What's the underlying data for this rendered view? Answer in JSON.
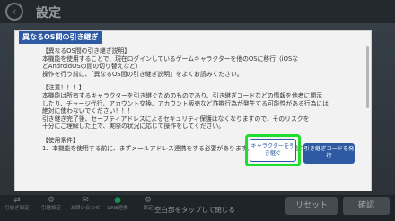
{
  "background": {
    "title": "設定",
    "nav": [
      {
        "label": "引継ぎ設定",
        "icon": "transfer-icon"
      },
      {
        "label": "引継設定",
        "icon": "settings-icon"
      },
      {
        "label": "お問い合わせ",
        "icon": "contact-icon"
      },
      {
        "label": "LINE連携",
        "icon": "line-icon"
      },
      {
        "label": "設定",
        "icon": "gear-icon"
      }
    ],
    "reset_label": "リセット",
    "confirm_label": "確認",
    "hint": "空白部をタップして閉じる"
  },
  "dialog": {
    "title": "異なるOS間の引き継ぎ",
    "lines": [
      "【異なるOS間の引き継ぎ説明】",
      "本機能を使用することで、現在ログインしているゲームキャラクターを他のOSに移行（iOSな",
      "どAndroidOSの間の切り替えなど）",
      "操作を行う前に、「異なるOS間の引き継ぎ説明」をよくお読みください。",
      "",
      "【注意！！！】",
      "本機能は所有するキャラクターを引き継ぐためのものであり、引き継ぎコードなどの情報を他者に開示",
      "したり、チャージ代行、アカウント交換、アカウント販売など詐欺行為が発生する可能性がある行為には",
      "絶対に使わないでください！！！",
      "引き継ぎ完了後、セーフティアドレスによるセキュリティ保護はなくなりますので、そのリスクを",
      "十分にご理解した上で、実際の状況に応じて操作をしてください。",
      "",
      "【使用条件】",
      "1、本機能を使用する前に、まずメールアドレス連携をする必要があります。連携の状況を確認でき"
    ],
    "btn_character_transfer": "キャラクターを引き継ぐ",
    "btn_issue_code": "引き継ぎコードを発行"
  }
}
